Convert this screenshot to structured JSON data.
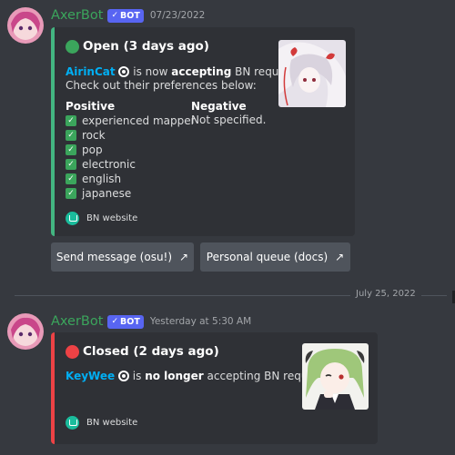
{
  "messages": [
    {
      "username": "AxerBot",
      "bot_tag": "BOT",
      "timestamp": "07/23/2022",
      "embed": {
        "status_title": "Open (3 days ago)",
        "status_color": "#3ba55c",
        "accent_color": "#43b581",
        "user": "AirinCat",
        "desc_mid": " is now ",
        "desc_bold": "accepting",
        "desc_end": " BN requests!",
        "desc_line2": "Check out their preferences below:",
        "positive_label": "Positive",
        "positive_items": [
          "experienced mapper",
          "rock",
          "pop",
          "electronic",
          "english",
          "japanese"
        ],
        "negative_label": "Negative",
        "negative_value": "Not specified.",
        "footer": "BN website"
      },
      "buttons": [
        {
          "label": "Send message (osu!)",
          "icon": "external-link-icon"
        },
        {
          "label": "Personal queue (docs)",
          "icon": "external-link-icon"
        }
      ]
    },
    {
      "username": "AxerBot",
      "bot_tag": "BOT",
      "timestamp": "Yesterday at 5:30 AM",
      "embed": {
        "status_title": "Closed (2 days ago)",
        "status_color": "#ed4245",
        "accent_color": "#ed4245",
        "user": "KeyWee",
        "desc_mid": " is ",
        "desc_bold": "no longer",
        "desc_end": " accepting BN requests.",
        "footer": "BN website"
      }
    }
  ],
  "date_divider": "July 25, 2022"
}
